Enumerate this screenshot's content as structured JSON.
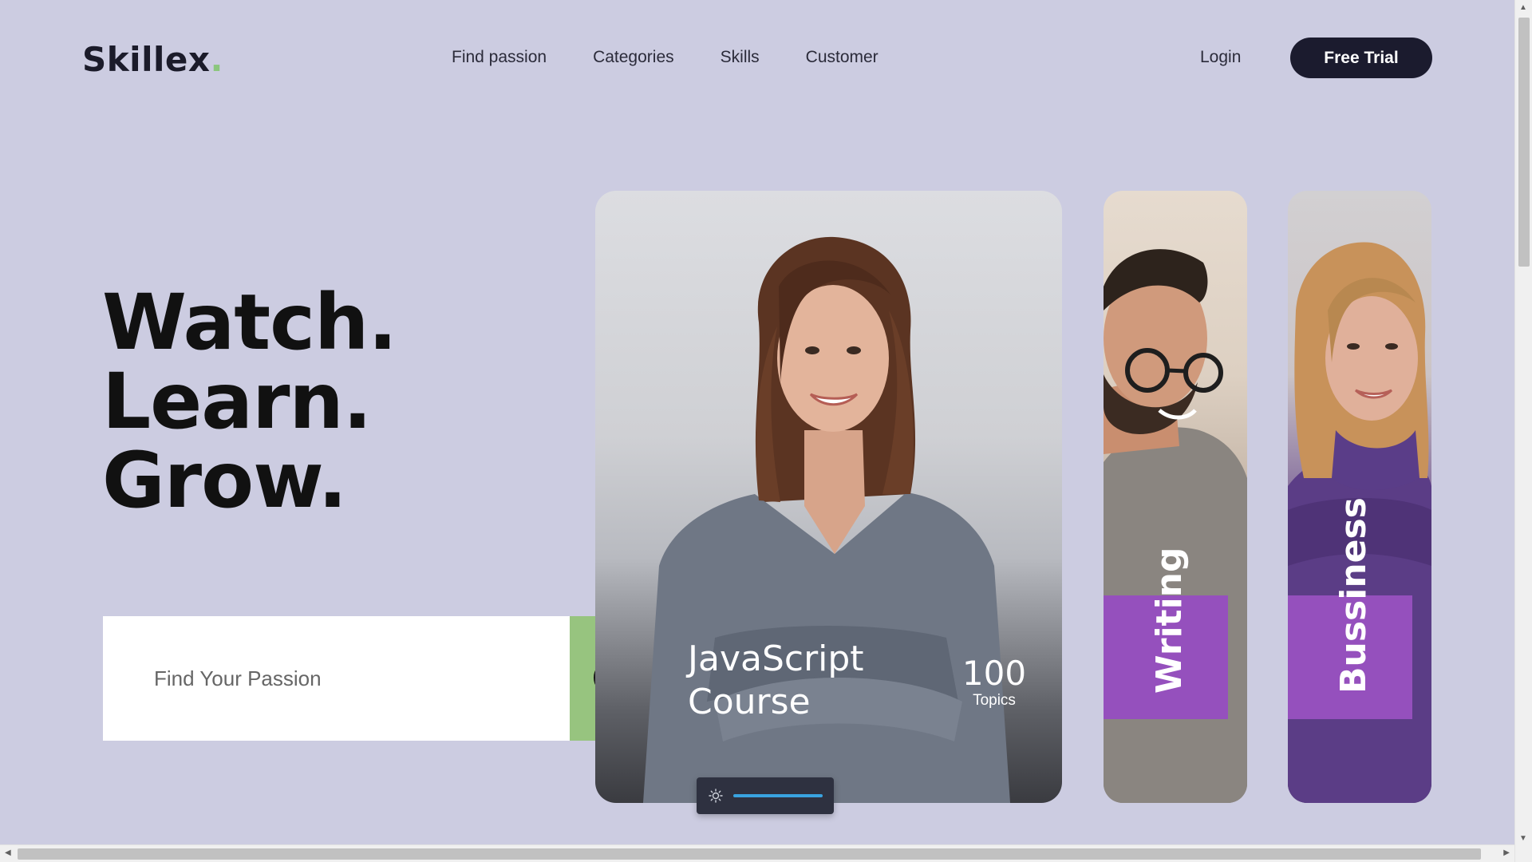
{
  "header": {
    "logo_text": "Skillex",
    "logo_dot": ".",
    "nav": [
      {
        "label": "Find passion"
      },
      {
        "label": "Categories"
      },
      {
        "label": "Skills"
      },
      {
        "label": "Customer"
      }
    ],
    "login_label": "Login",
    "trial_label": "Free Trial"
  },
  "hero": {
    "lines": [
      "Watch.",
      "Learn.",
      "Grow."
    ]
  },
  "search": {
    "placeholder": "Find Your Passion",
    "go_label": "Go"
  },
  "cards": {
    "main": {
      "title_line1": "JavaScript",
      "title_line2": "Course",
      "count": "100",
      "count_label": "Topics"
    },
    "writing": {
      "label": "Writing"
    },
    "business": {
      "label": "Bussiness"
    }
  },
  "colors": {
    "background": "#cccce1",
    "accent_green": "#97c47f",
    "accent_purple": "#9550bd",
    "dark": "#1b1b2e",
    "slider_track": "#39a3e0"
  },
  "icons": {
    "slider_icon": "sun-icon"
  }
}
